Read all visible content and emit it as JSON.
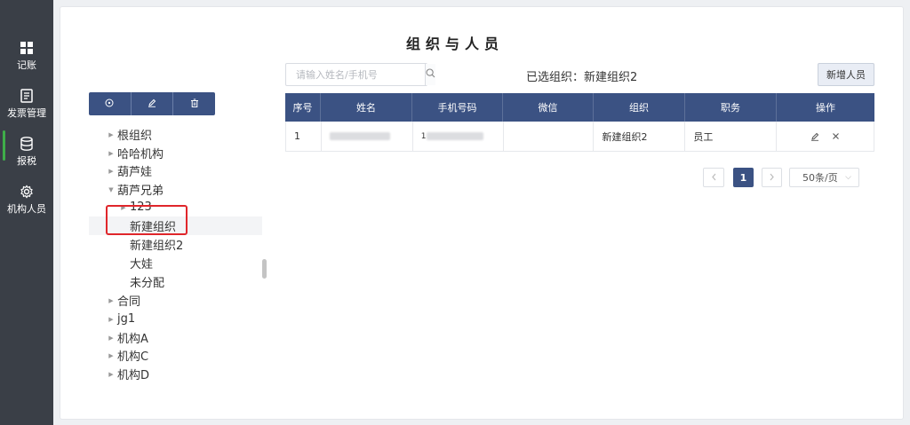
{
  "sidebar": {
    "items": [
      {
        "label": "记账",
        "icon": "grid-icon"
      },
      {
        "label": "发票管理",
        "icon": "document-icon"
      },
      {
        "label": "报税",
        "icon": "database-icon"
      },
      {
        "label": "机构人员",
        "icon": "gear-icon"
      }
    ],
    "active_index": 2,
    "active_color": "#3fae49"
  },
  "page": {
    "title": "组织与人员"
  },
  "tree_toolbar": {
    "buttons": [
      "add-circle-icon",
      "edit-icon",
      "trash-icon"
    ]
  },
  "tree": {
    "nodes": [
      {
        "label": "根组织",
        "arrow": "right",
        "level": 0
      },
      {
        "label": "哈哈机构",
        "arrow": "right",
        "level": 0
      },
      {
        "label": "葫芦娃",
        "arrow": "right",
        "level": 0
      },
      {
        "label": "葫芦兄弟",
        "arrow": "down",
        "level": 0
      },
      {
        "label": "123",
        "arrow": "right",
        "level": 1
      },
      {
        "label": "新建组织",
        "arrow": "",
        "level": 1,
        "selected": true
      },
      {
        "label": "新建组织2",
        "arrow": "",
        "level": 1
      },
      {
        "label": "大娃",
        "arrow": "",
        "level": 1
      },
      {
        "label": "未分配",
        "arrow": "",
        "level": 1
      },
      {
        "label": "合同",
        "arrow": "right",
        "level": 0
      },
      {
        "label": "jg1",
        "arrow": "right",
        "level": 0
      },
      {
        "label": "机构A",
        "arrow": "right",
        "level": 0
      },
      {
        "label": "机构C",
        "arrow": "right",
        "level": 0
      },
      {
        "label": "机构D",
        "arrow": "right",
        "level": 0
      }
    ]
  },
  "search": {
    "placeholder": "请输入姓名/手机号",
    "value": ""
  },
  "selected_org": "已选组织：新建组织2",
  "add_button": "新增人员",
  "table": {
    "columns": [
      "序号",
      "姓名",
      "手机号码",
      "微信",
      "组织",
      "职务",
      "操作"
    ],
    "rows": [
      {
        "index": "1",
        "name": "",
        "phone": "1",
        "wechat": "",
        "org": "新建组织2",
        "position": "员工"
      }
    ]
  },
  "pagination": {
    "current": "1",
    "page_size": "50条/页"
  },
  "colors": {
    "primary": "#3b5283",
    "highlight": "#e0262b",
    "sidebar_bg": "#3a3f47"
  }
}
